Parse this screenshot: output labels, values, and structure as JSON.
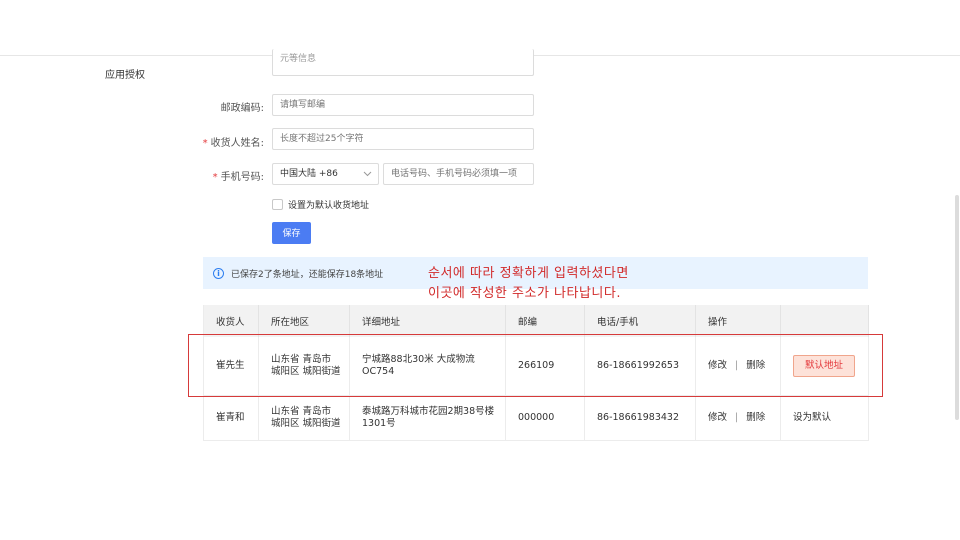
{
  "sidebar": {
    "label": "应用授权"
  },
  "form": {
    "address_tail": "元等信息",
    "postcode": {
      "label": "邮政编码:",
      "placeholder": "请填写邮编"
    },
    "receiver": {
      "label": "收货人姓名:",
      "placeholder": "长度不超过25个字符",
      "required_mark": "*"
    },
    "phone": {
      "label": "手机号码:",
      "required_mark": "*",
      "country": "中国大陆 +86",
      "placeholder": "电话号码、手机号码必须填一项"
    },
    "default_checkbox_label": "设置为默认收货地址",
    "save_label": "保存"
  },
  "info": {
    "text": "已保存2了条地址，还能保存18条地址"
  },
  "annotation": {
    "line1": "순서에 따라 정확하게 입력하셨다면",
    "line2": "이곳에 작성한 주소가 나타납니다."
  },
  "table": {
    "headers": [
      "收货人",
      "所在地区",
      "详细地址",
      "邮编",
      "电话/手机",
      "操作",
      ""
    ],
    "rows": [
      {
        "name": "崔先生",
        "region": "山东省 青岛市 城阳区 城阳街道",
        "address": "宁城路88北30米 大成物流 OC754",
        "postcode": "266109",
        "phone": "86-18661992653",
        "edit": "修改",
        "delete": "删除",
        "status": "默认地址"
      },
      {
        "name": "崔青和",
        "region": "山东省 青岛市 城阳区 城阳街道",
        "address": "泰城路万科城市花园2期38号楼1301号",
        "postcode": "000000",
        "phone": "86-18661983432",
        "edit": "修改",
        "delete": "删除",
        "status": "设为默认"
      }
    ]
  },
  "colors": {
    "primary": "#4b7cf3",
    "annotation": "#d12a2a",
    "info_bg": "#e8f3ff",
    "badge_bg": "#fde2d9"
  }
}
